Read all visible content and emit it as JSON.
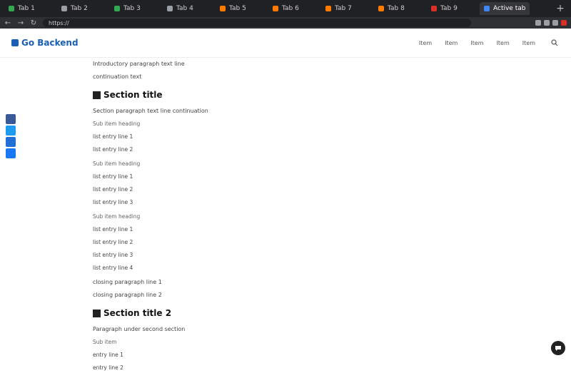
{
  "browser": {
    "tabs": [
      {
        "label": "Tab 1",
        "color": "#34a853"
      },
      {
        "label": "Tab 2",
        "color": "#9aa0a6"
      },
      {
        "label": "Tab 3",
        "color": "#34a853"
      },
      {
        "label": "Tab 4",
        "color": "#9aa0a6"
      },
      {
        "label": "Tab 5",
        "color": "#ff7a00"
      },
      {
        "label": "Tab 6",
        "color": "#ff7a00"
      },
      {
        "label": "Tab 7",
        "color": "#ff7a00"
      },
      {
        "label": "Tab 8",
        "color": "#ff7a00"
      },
      {
        "label": "Tab 9",
        "color": "#d93025"
      },
      {
        "label": "Active tab",
        "color": "#4285f4"
      }
    ],
    "new_tab": "+",
    "url": "https://",
    "back": "←",
    "forward": "→",
    "reload": "↻"
  },
  "site": {
    "logo": "Go Backend",
    "nav": [
      "Item",
      "Item",
      "Item",
      "Item",
      "Item"
    ]
  },
  "article": {
    "intro": [
      "Introductory paragraph text line",
      "continuation text"
    ],
    "section1_title": "Section title",
    "section1_p1": "Section paragraph text line continuation",
    "list1_title": "Sub item heading",
    "list1": [
      "list entry line 1",
      "list entry line 2"
    ],
    "list2_title": "Sub item heading",
    "list2": [
      "list entry line 1",
      "list entry line 2",
      "list entry line 3"
    ],
    "list3_title": "Sub item heading",
    "list3": [
      "list entry line 1",
      "list entry line 2",
      "list entry line 3",
      "list entry line 4"
    ],
    "para_end": [
      "closing paragraph line 1",
      "closing paragraph line 2"
    ],
    "section2_title": "Section title 2",
    "section2_p1": "Paragraph under second section",
    "list4_title": "Sub item",
    "list4": [
      "entry line 1",
      "entry line 2"
    ]
  },
  "share": [
    "twitter",
    "facebook",
    "hatena",
    "line"
  ]
}
